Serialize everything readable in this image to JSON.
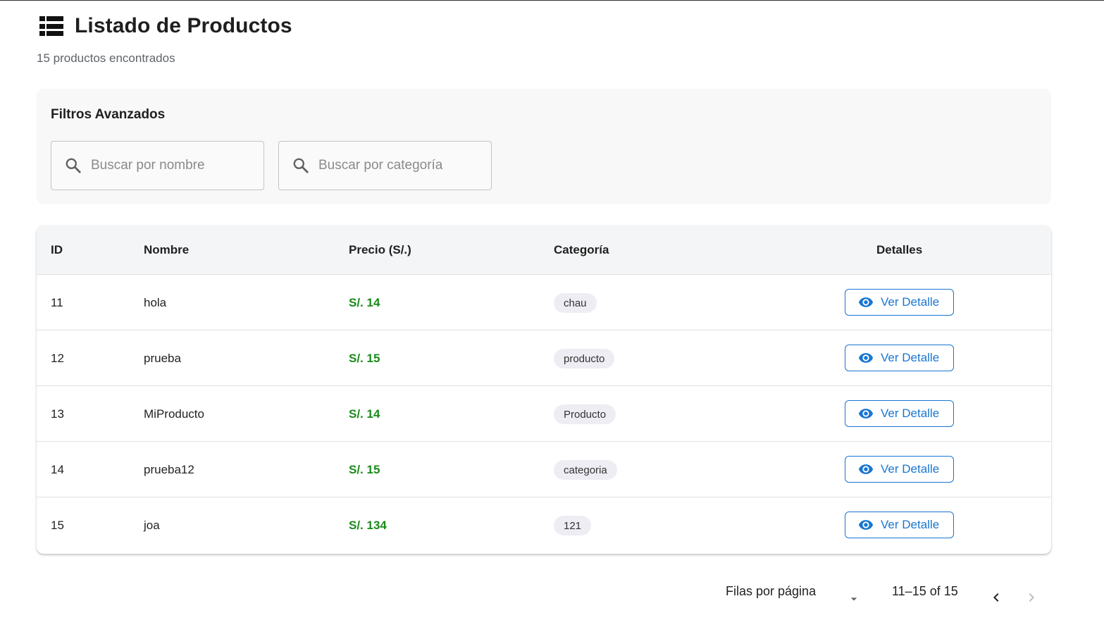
{
  "header": {
    "title": "Listado de Productos",
    "subtitle": "15 productos encontrados",
    "icon": "list-icon"
  },
  "filters": {
    "title": "Filtros Avanzados",
    "name_search": {
      "placeholder": "Buscar por nombre",
      "value": ""
    },
    "category_search": {
      "placeholder": "Buscar por categoría",
      "value": ""
    }
  },
  "table": {
    "columns": {
      "id": "ID",
      "name": "Nombre",
      "price": "Precio (S/.)",
      "category": "Categoría",
      "details": "Detalles"
    },
    "rows": [
      {
        "id": "11",
        "name": "hola",
        "price": "S/. 14",
        "category": "chau",
        "action": "Ver Detalle"
      },
      {
        "id": "12",
        "name": "prueba",
        "price": "S/. 15",
        "category": "producto",
        "action": "Ver Detalle"
      },
      {
        "id": "13",
        "name": "MiProducto",
        "price": "S/. 14",
        "category": "Producto",
        "action": "Ver Detalle"
      },
      {
        "id": "14",
        "name": "prueba12",
        "price": "S/. 15",
        "category": "categoria",
        "action": "Ver Detalle"
      },
      {
        "id": "15",
        "name": "joa",
        "price": "S/. 134",
        "category": "121",
        "action": "Ver Detalle"
      }
    ]
  },
  "pagination": {
    "rows_per_page_label": "Filas por página",
    "range": "11–15 of 15"
  },
  "colors": {
    "accent": "#1976d2",
    "price": "#1a8a1a",
    "chip_bg": "#eeedf4"
  }
}
